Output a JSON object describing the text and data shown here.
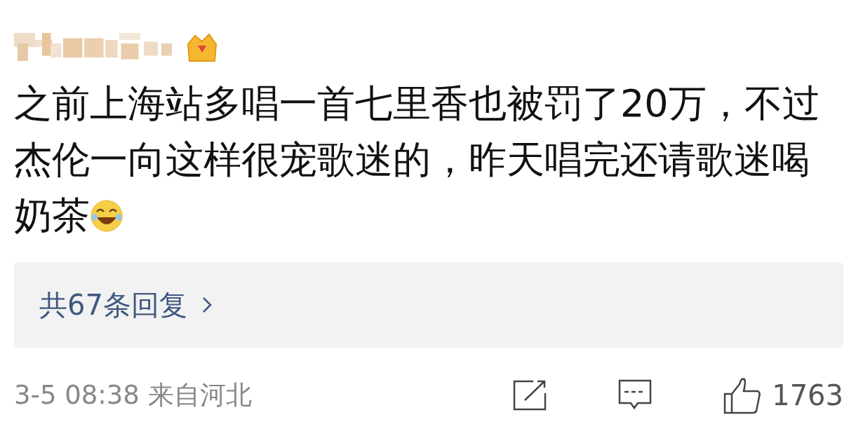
{
  "comment": {
    "lines": [
      "之前上海站多唱一首七里香也被罚了20万，不过",
      "杰伦一向这样很宠歌迷的，昨天唱完还请歌迷喝",
      "奶茶"
    ],
    "replies": {
      "label": "共67条回复"
    },
    "meta": "3-5 08:38 来自河北",
    "likes": "1763"
  }
}
